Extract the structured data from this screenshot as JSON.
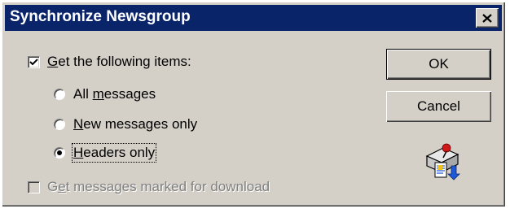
{
  "window": {
    "title": "Synchronize Newsgroup",
    "close_icon": "close-icon"
  },
  "options": {
    "get_items": {
      "prefix": "",
      "mnemonic": "G",
      "rest": "et the following items:",
      "checked": true
    },
    "all_messages": {
      "prefix": "All ",
      "mnemonic": "m",
      "rest": "essages",
      "selected": false
    },
    "new_messages": {
      "prefix": "",
      "mnemonic": "N",
      "rest": "ew messages only",
      "selected": false
    },
    "headers_only": {
      "prefix": "",
      "mnemonic": "H",
      "rest": "eaders only",
      "selected": true
    },
    "marked_download": {
      "prefix": "G",
      "mnemonic": "e",
      "rest": "t messages marked for download",
      "checked": false,
      "disabled": true
    }
  },
  "buttons": {
    "ok": "OK",
    "cancel": "Cancel"
  },
  "icons": {
    "sync": "sync-newsgroup-icon"
  },
  "colors": {
    "title_bar": "#0a246a",
    "face": "#d4d0c8",
    "arrow": "#1e5ad8",
    "pin": "#d01818"
  }
}
